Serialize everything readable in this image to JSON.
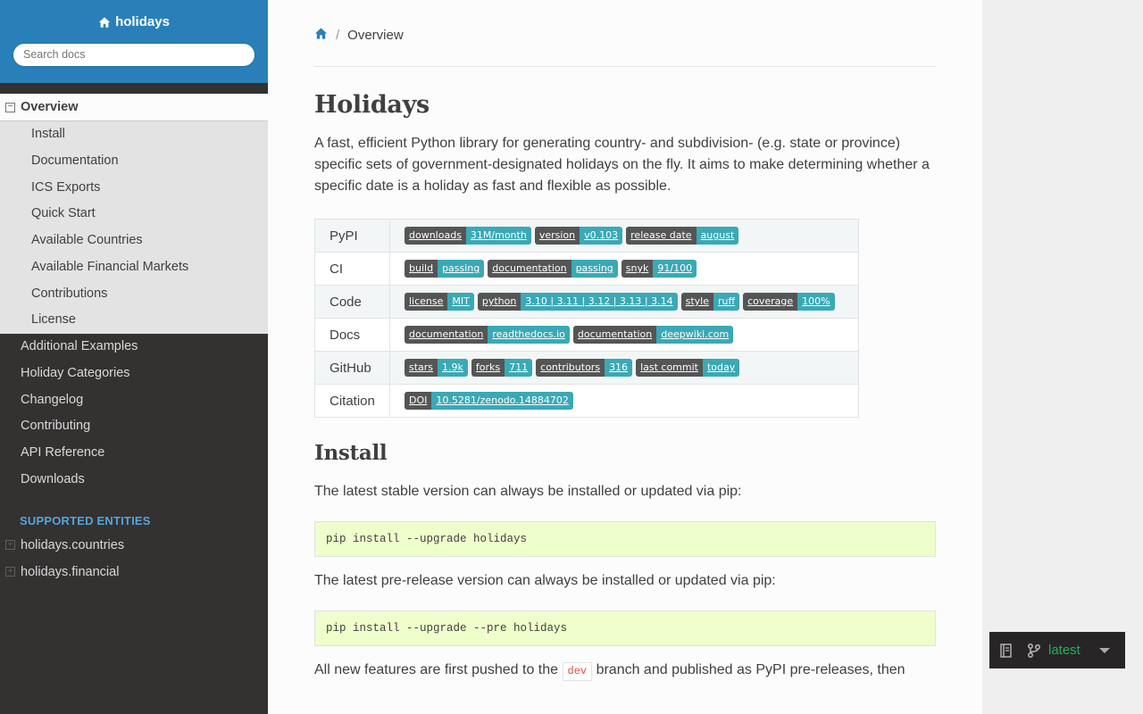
{
  "sidebar": {
    "project_title": "holidays",
    "search_placeholder": "Search docs",
    "current_item": "Overview",
    "current_toggle": "−",
    "sub_items": [
      "Install",
      "Documentation",
      "ICS Exports",
      "Quick Start",
      "Available Countries",
      "Available Financial Markets",
      "Contributions",
      "License"
    ],
    "top_items": [
      "Additional Examples",
      "Holiday Categories",
      "Changelog",
      "Contributing",
      "API Reference",
      "Downloads"
    ],
    "caption": "SUPPORTED ENTITIES",
    "entities": [
      "holidays.countries",
      "holidays.financial"
    ],
    "entity_toggle": "+"
  },
  "breadcrumb": {
    "icon": "home-icon",
    "separator": "/",
    "current": "Overview"
  },
  "content": {
    "title": "Holidays",
    "intro": "A fast, efficient Python library for generating country- and subdivision- (e.g. state or province) specific sets of government-designated holidays on the fly. It aims to make determining whether a specific date is a holiday as fast and flexible as possible.",
    "badge_rows": [
      {
        "label": "PyPI",
        "badges": [
          {
            "left": "downloads",
            "right": "31M/month"
          },
          {
            "left": "version",
            "right": "v0.103"
          },
          {
            "left": "release date",
            "right": "august"
          }
        ]
      },
      {
        "label": "CI",
        "badges": [
          {
            "left": "build",
            "right": "passing"
          },
          {
            "left": "documentation",
            "right": "passing"
          },
          {
            "left": "snyk",
            "right": "91/100"
          }
        ]
      },
      {
        "label": "Code",
        "badges": [
          {
            "left": "license",
            "right": "MIT"
          },
          {
            "left": "python",
            "right": "3.10 | 3.11 | 3.12 | 3.13 | 3.14"
          },
          {
            "left": "style",
            "right": "ruff"
          },
          {
            "left": "coverage",
            "right": "100%"
          }
        ]
      },
      {
        "label": "Docs",
        "badges": [
          {
            "left": "documentation",
            "right": "readthedocs.io"
          },
          {
            "left": "documentation",
            "right": "deepwiki.com"
          }
        ]
      },
      {
        "label": "GitHub",
        "badges": [
          {
            "left": "stars",
            "right": "1.9k"
          },
          {
            "left": "forks",
            "right": "711"
          },
          {
            "left": "contributors",
            "right": "316"
          },
          {
            "left": "last commit",
            "right": "today"
          }
        ]
      },
      {
        "label": "Citation",
        "badges": [
          {
            "left": "DOI",
            "right": "10.5281/zenodo.14884702"
          }
        ]
      }
    ],
    "install_heading": "Install",
    "install_text": "The latest stable version can always be installed or updated via pip:",
    "install_cmd": "pip install --upgrade holidays",
    "prerelease_text": "The latest pre-release version can always be installed or updated via pip:",
    "prerelease_cmd": "pip install --upgrade --pre holidays",
    "features_text_before": "All new features are first pushed to the",
    "features_literal": "dev",
    "features_text_after": "branch and published as PyPI pre-releases, then"
  },
  "flyout": {
    "book_icon": "book-icon",
    "branch_icon": "git-branch-icon",
    "version": "latest",
    "caret_icon": "caret-down-icon"
  },
  "colors": {
    "sidebar_header": "#2980b9",
    "sidebar_bg": "#343131",
    "caption": "#55a5d9",
    "badge_left": "#555555",
    "badge_right": "#3aa9b5",
    "code_bg": "#eeffcc",
    "version_green": "#27ae60"
  }
}
